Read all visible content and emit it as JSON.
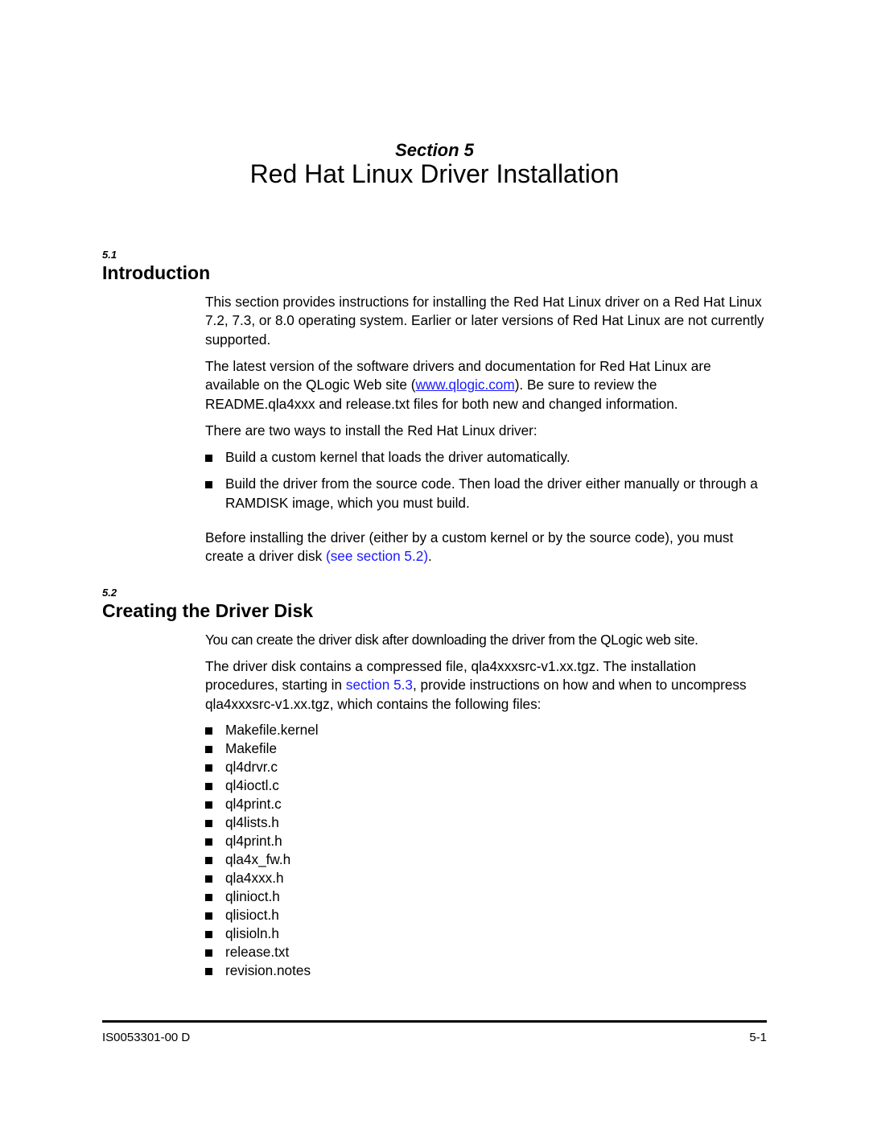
{
  "header": {
    "section_label": "Section 5",
    "title": "Red Hat Linux Driver Installation"
  },
  "sections": [
    {
      "number": "5.1",
      "title": "Introduction",
      "paragraphs": [
        "This section provides instructions for installing the Red Hat Linux driver on a Red Hat Linux 7.2, 7.3, or 8.0 operating system. Earlier or later versions of Red Hat Linux are not currently supported.",
        {
          "before": "The latest version of the software drivers and documentation for Red Hat Linux are available on the QLogic Web site (",
          "link": "www.qlogic.com",
          "after": "). Be sure to review the README.qla4xxx and release.txt files for both new and changed information."
        },
        "There are two ways to install the Red Hat Linux driver:"
      ],
      "bullets": [
        "Build a custom kernel that loads the driver automatically.",
        "Build the driver from the source code. Then load the driver either manually or through a RAMDISK image, which you must build."
      ],
      "closing": {
        "before": "Before installing the driver (either by a custom kernel or by the source code), you must create a driver disk ",
        "link": "(see section 5.2)",
        "after": "."
      }
    },
    {
      "number": "5.2",
      "title": "Creating the Driver Disk",
      "paragraphs": [
        "You can create the driver disk after downloading the driver from the QLogic web site.",
        {
          "before": "The driver disk contains a compressed file, qla4xxxsrc-v1.xx.tgz. The installation procedures, starting in ",
          "link": "section 5.3",
          "after": ", provide instructions on how and when to uncompress qla4xxxsrc-v1.xx.tgz, which contains the following files:"
        }
      ],
      "files": [
        "Makefile.kernel",
        "Makefile",
        "ql4drvr.c",
        "ql4ioctl.c",
        "ql4print.c",
        "ql4lists.h",
        "ql4print.h",
        "qla4x_fw.h",
        "qla4xxx.h",
        "qlinioct.h",
        "qlisioct.h",
        "qlisioln.h",
        "release.txt",
        "revision.notes"
      ]
    }
  ],
  "footer": {
    "doc_id": "IS0053301-00  D",
    "page_number": "5-1"
  },
  "colors": {
    "link": "#1a1aff",
    "text": "#000000"
  }
}
